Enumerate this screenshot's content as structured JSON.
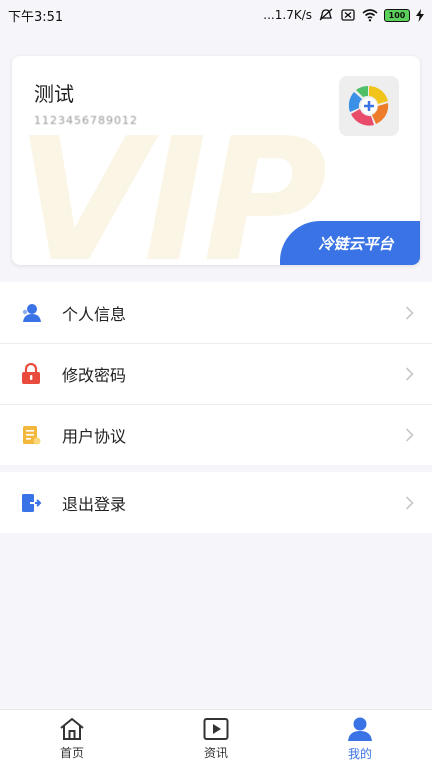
{
  "status_bar": {
    "time": "下午3:51",
    "network_speed": "...1.7K/s",
    "battery": "100"
  },
  "profile": {
    "name": "测试",
    "account_id": "1123456789012",
    "platform_label": "冷链云平台",
    "watermark": "VIP"
  },
  "menu": {
    "personal_info": "个人信息",
    "change_password": "修改密码",
    "user_agreement": "用户协议",
    "logout": "退出登录"
  },
  "bottom_nav": {
    "home": "首页",
    "news": "资讯",
    "mine": "我的"
  },
  "colors": {
    "accent": "#3a73e6",
    "lock": "#e94b3c",
    "agreement": "#f3b73b"
  }
}
